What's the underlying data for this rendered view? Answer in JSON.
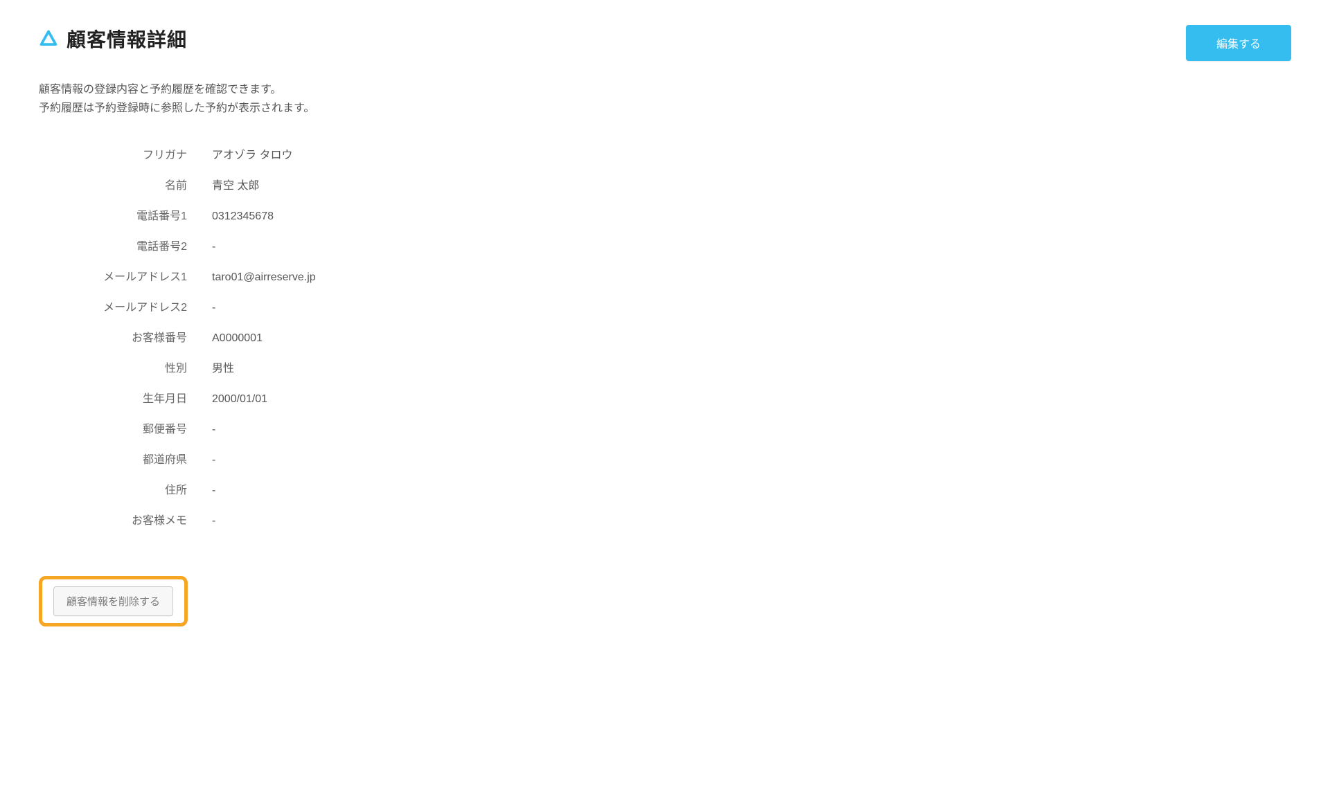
{
  "header": {
    "title": "顧客情報詳細",
    "edit_button_label": "編集する"
  },
  "description": {
    "line1": "顧客情報の登録内容と予約履歴を確認できます。",
    "line2": "予約履歴は予約登録時に参照した予約が表示されます。"
  },
  "fields": [
    {
      "label": "フリガナ",
      "value": "アオゾラ タロウ"
    },
    {
      "label": "名前",
      "value": "青空 太郎"
    },
    {
      "label": "電話番号1",
      "value": "0312345678"
    },
    {
      "label": "電話番号2",
      "value": "-"
    },
    {
      "label": "メールアドレス1",
      "value": "taro01@airreserve.jp"
    },
    {
      "label": "メールアドレス2",
      "value": "-"
    },
    {
      "label": "お客様番号",
      "value": "A0000001"
    },
    {
      "label": "性別",
      "value": "男性"
    },
    {
      "label": "生年月日",
      "value": "2000/01/01"
    },
    {
      "label": "郵便番号",
      "value": "-"
    },
    {
      "label": "都道府県",
      "value": "-"
    },
    {
      "label": "住所",
      "value": "-"
    },
    {
      "label": "お客様メモ",
      "value": "-"
    }
  ],
  "actions": {
    "delete_button_label": "顧客情報を削除する"
  }
}
